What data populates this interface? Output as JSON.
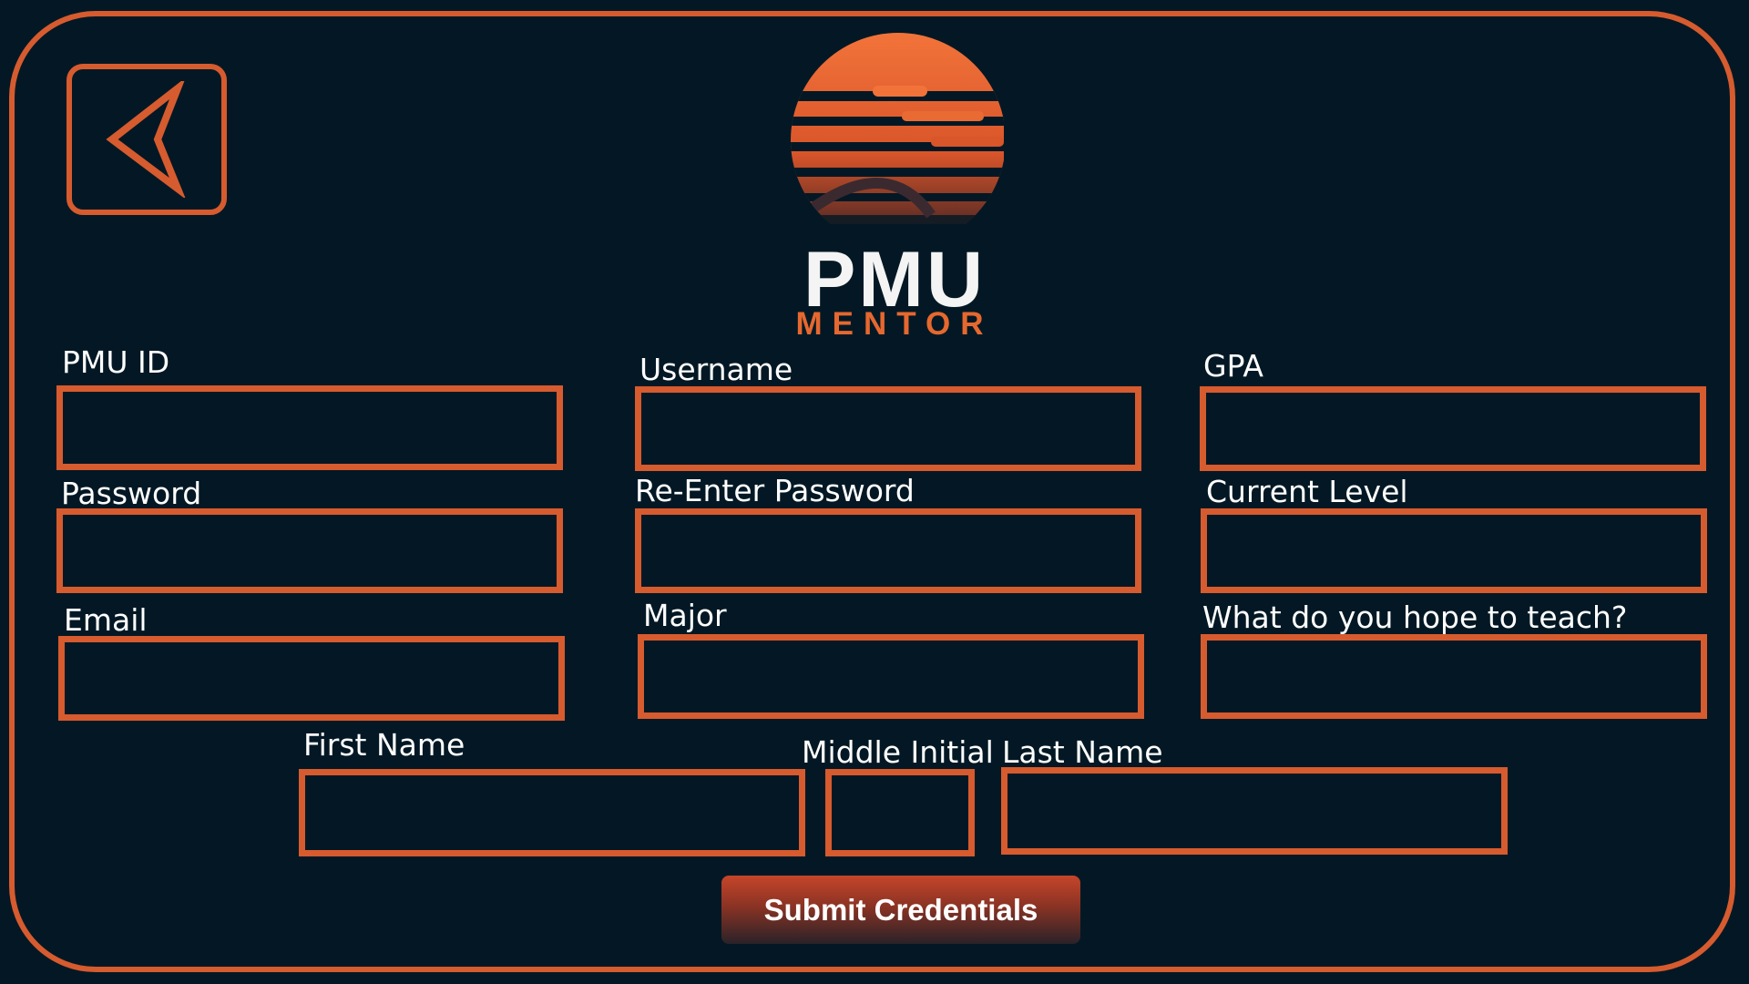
{
  "app": {
    "brand_name": "PMU",
    "brand_subtitle": "MENTOR"
  },
  "colors": {
    "background": "#031824",
    "accent": "#d65b2f"
  },
  "navigation": {
    "back_icon": "back-arrow-icon"
  },
  "form": {
    "pmu_id": {
      "label": "PMU ID",
      "value": ""
    },
    "username": {
      "label": "Username",
      "value": ""
    },
    "gpa": {
      "label": "GPA",
      "value": ""
    },
    "password": {
      "label": "Password",
      "value": ""
    },
    "reenter_password": {
      "label": "Re-Enter Password",
      "value": ""
    },
    "current_level": {
      "label": "Current Level",
      "value": ""
    },
    "email": {
      "label": "Email",
      "value": ""
    },
    "major": {
      "label": "Major",
      "value": ""
    },
    "teach": {
      "label": "What do you hope to teach?",
      "value": ""
    },
    "first_name": {
      "label": "First Name",
      "value": ""
    },
    "middle_initial": {
      "label": "Middle Initial",
      "value": ""
    },
    "last_name": {
      "label": "Last Name",
      "value": ""
    }
  },
  "submit_label": "Submit Credentials"
}
